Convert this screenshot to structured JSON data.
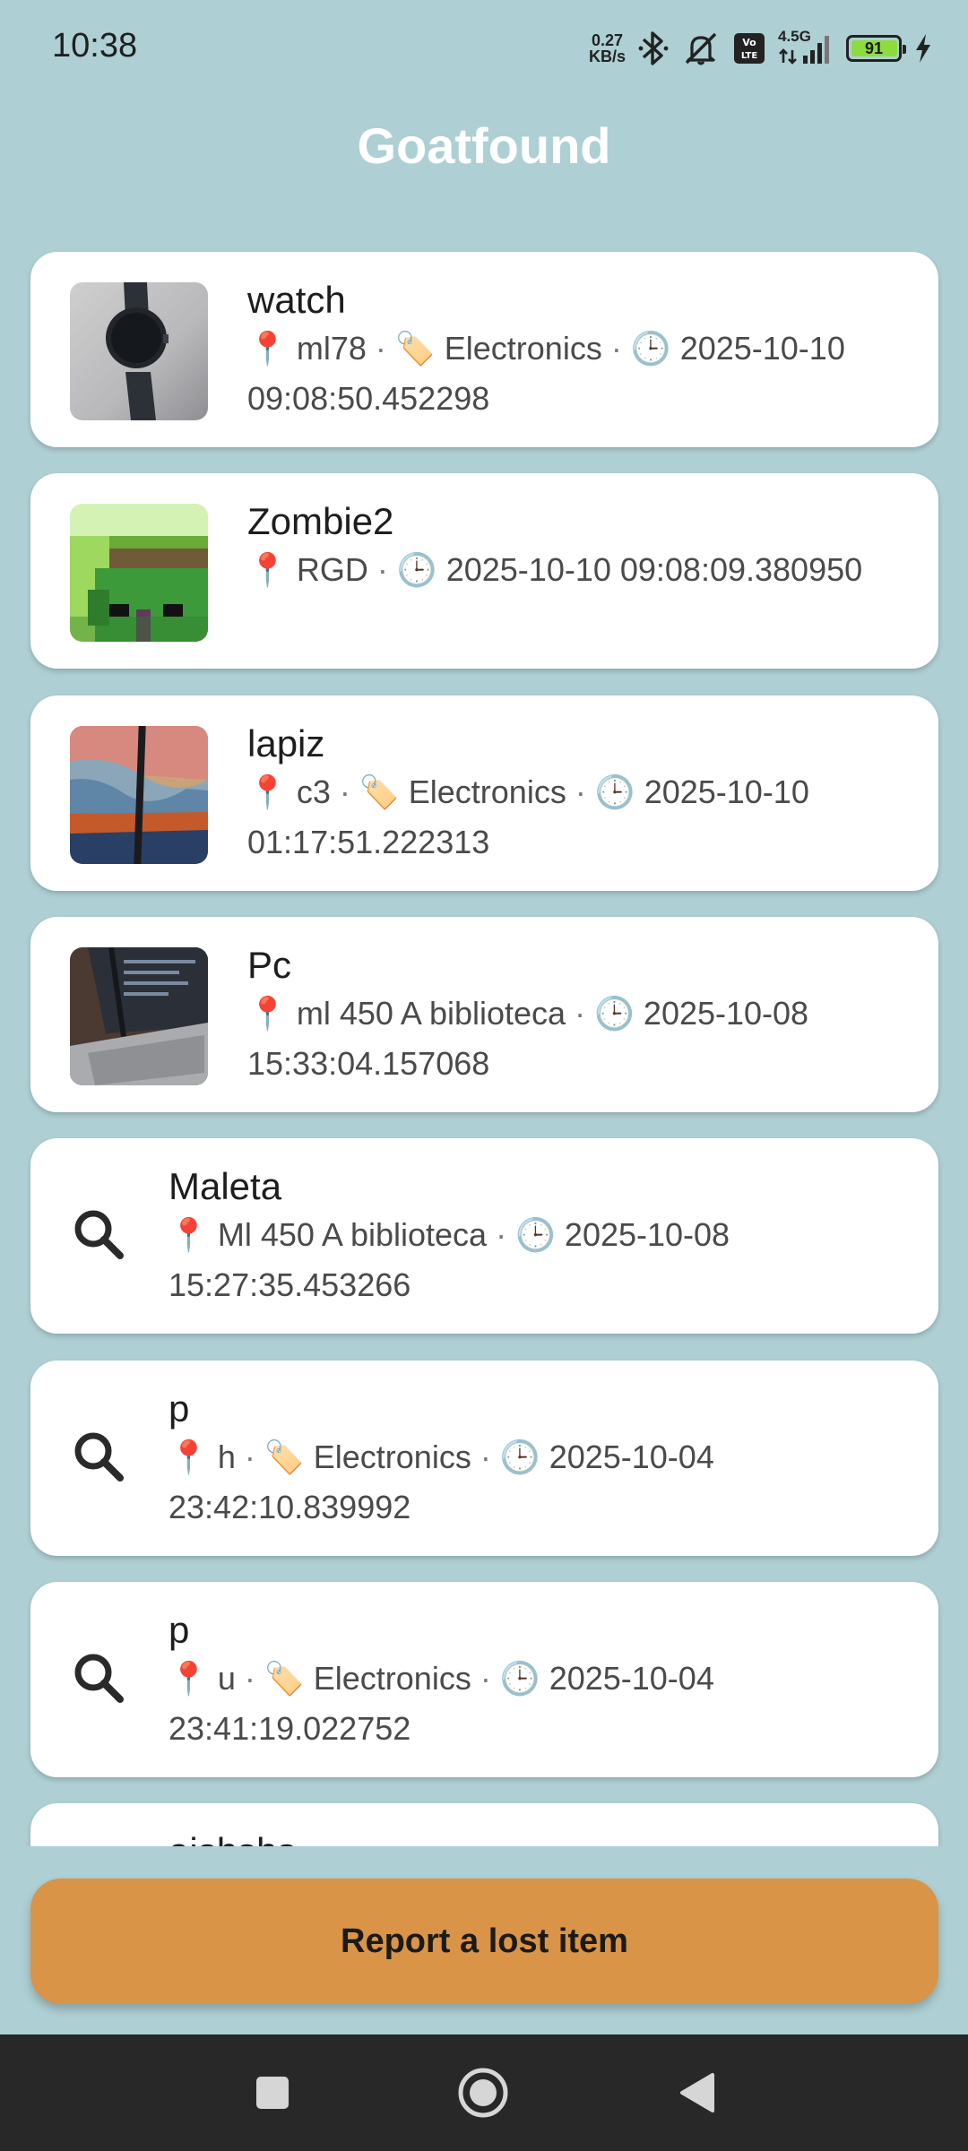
{
  "status_bar": {
    "time": "10:38",
    "net_speed_value": "0.27",
    "net_speed_unit": "KB/s",
    "network_label": "4.5G",
    "volte_label": "Vo LTE",
    "battery_level": "91",
    "battery_fraction": 0.91,
    "icons": [
      "bluetooth-icon",
      "mute-icon",
      "volte-icon",
      "signal-icon",
      "battery-icon",
      "charging-icon"
    ]
  },
  "header": {
    "title": "Goatfound"
  },
  "items": [
    {
      "name": "watch",
      "visual": "photo-watch",
      "location": "ml78",
      "category": "Electronics",
      "timestamp": "2025-10-10 09:08:50.452298"
    },
    {
      "name": "Zombie2",
      "visual": "pixel-zombie",
      "location": "RGD",
      "category": "",
      "timestamp": "2025-10-10 09:08:09.380950"
    },
    {
      "name": "lapiz",
      "visual": "photo-pencil",
      "location": "c3",
      "category": "Electronics",
      "timestamp": "2025-10-10 01:17:51.222313"
    },
    {
      "name": "Pc",
      "visual": "photo-laptop",
      "location": "ml 450 A biblioteca",
      "category": "",
      "timestamp": "2025-10-08 15:33:04.157068"
    },
    {
      "name": "Maleta",
      "visual": "search-icon",
      "location": "Ml 450 A biblioteca",
      "category": "",
      "timestamp": "2025-10-08 15:27:35.453266"
    },
    {
      "name": "p",
      "visual": "search-icon",
      "location": "h",
      "category": "Electronics",
      "timestamp": "2025-10-04 23:42:10.839992"
    },
    {
      "name": "p",
      "visual": "search-icon",
      "location": "u",
      "category": "Electronics",
      "timestamp": "2025-10-04 23:41:19.022752"
    },
    {
      "name": "aishshs",
      "visual": "search-icon",
      "location": "",
      "category": "",
      "timestamp": ""
    }
  ],
  "meta_icons": {
    "location": "📍",
    "category": "🏷️",
    "time": "🕒",
    "separator": "·"
  },
  "actions": {
    "report_button_label": "Report a lost item"
  },
  "nav_bar": {
    "buttons": [
      "recents-square-icon",
      "home-circle-icon",
      "back-triangle-icon"
    ]
  },
  "colors": {
    "background": "#aecfd3",
    "card": "#ffffff",
    "accent_button": "#d99447",
    "nav_bar": "#282828"
  }
}
